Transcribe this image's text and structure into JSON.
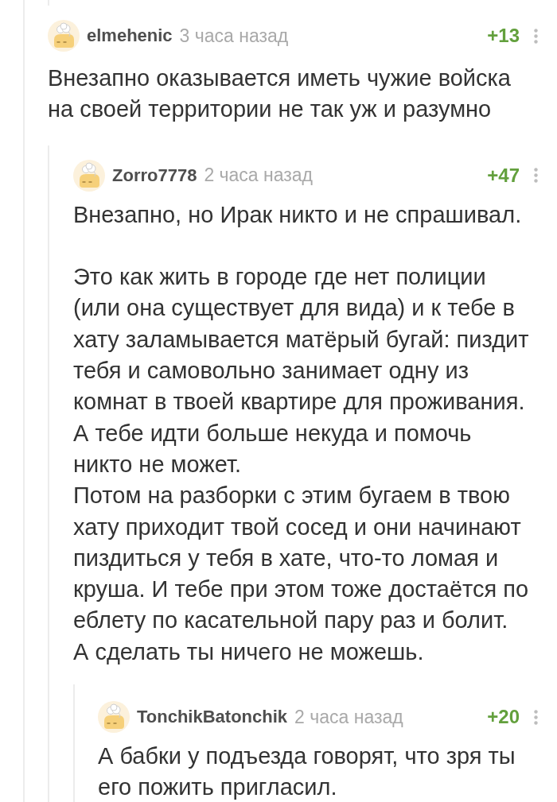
{
  "thread": {
    "comments": [
      {
        "author": "elmehenic",
        "time": "3 часа назад",
        "rating": "+13",
        "paragraphs": [
          "Внезапно оказывается иметь чужие войска на своей территории не так уж и разумно"
        ],
        "children": [
          {
            "author": "Zorro7778",
            "time": "2 часа назад",
            "rating": "+47",
            "paragraphs": [
              "Внезапно, но Ирак никто и не спрашивал.",
              "Это как жить в городе где нет полиции (или она существует для вида) и к тебе в хату заламывается матёрый бугай: пиздит тебя и самовольно занимает одну из комнат в твоей квартире для проживания. А тебе идти больше некуда и помочь никто не может.\nПотом на разборки с этим бугаем в твою хату приходит твой сосед и они начинают пиздиться у тебя в хате, что-то ломая и круша. И тебе при этом тоже достаётся по еблету по касательной пару раз и болит.\nА сделать ты ничего не можешь."
            ],
            "children": [
              {
                "author": "TonchikBatonchik",
                "time": "2 часа назад",
                "rating": "+20",
                "paragraphs": [
                  "А бабки у подъезда говорят, что зря ты его пожить пригласил."
                ]
              }
            ]
          }
        ]
      }
    ]
  }
}
